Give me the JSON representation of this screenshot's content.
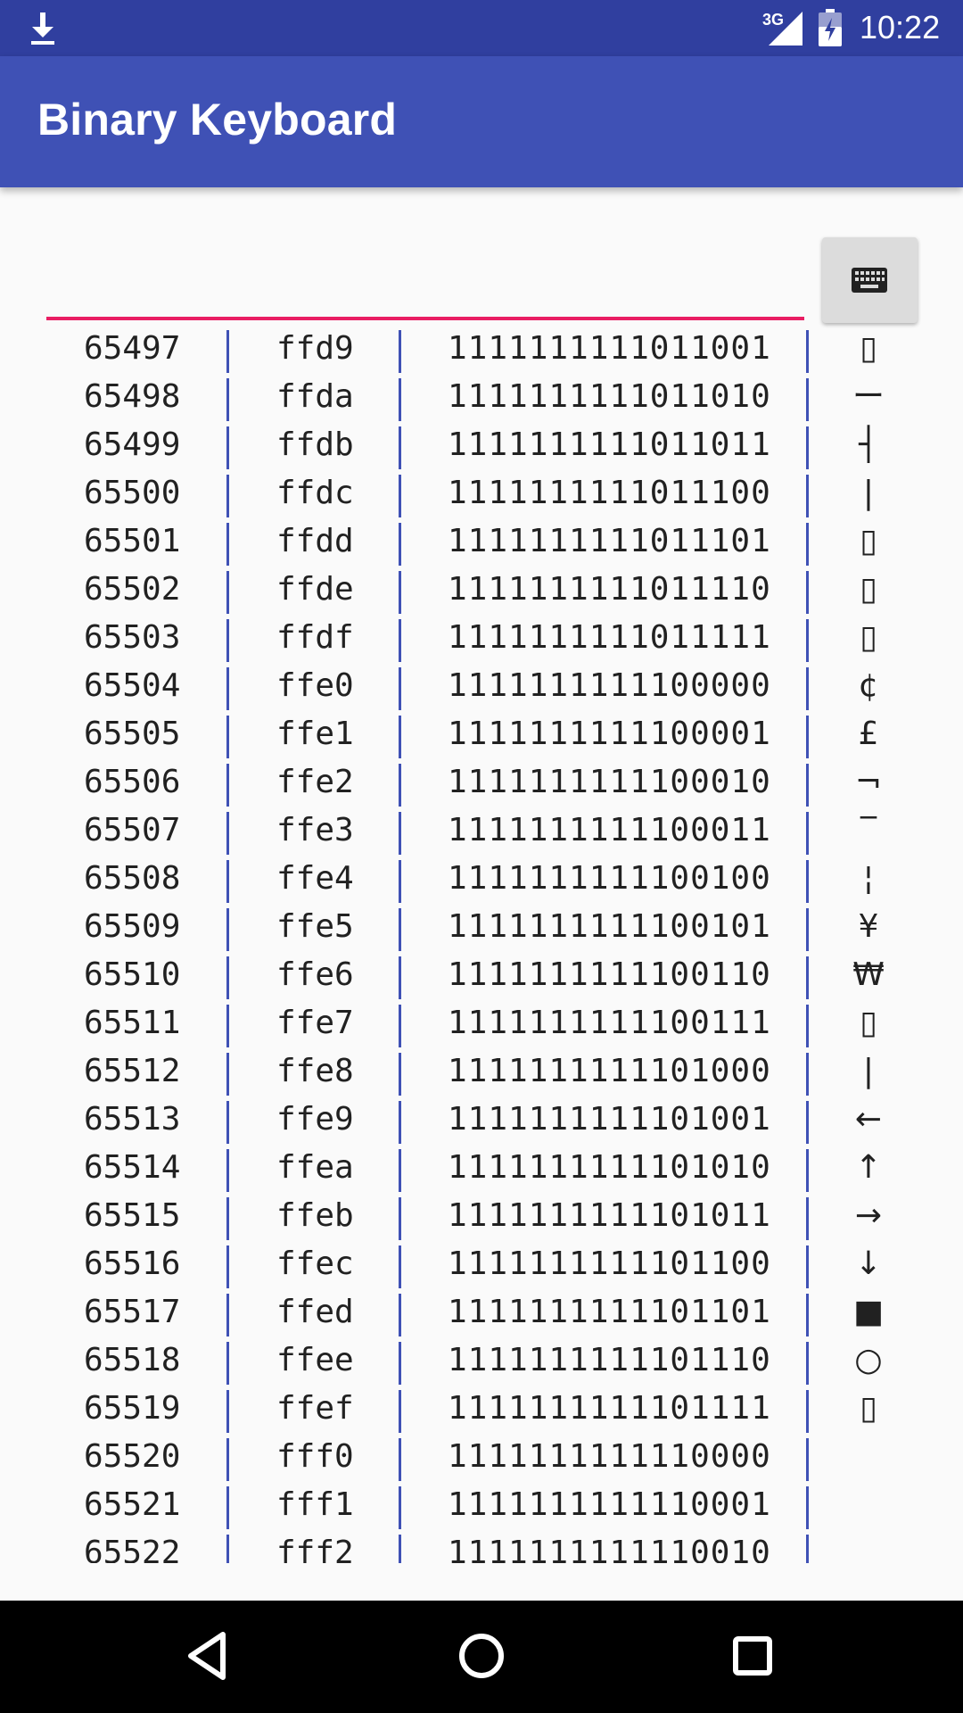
{
  "status_bar": {
    "network_type": "3G",
    "time": "10:22",
    "icons": [
      "download-icon",
      "signal-icon",
      "battery-icon"
    ]
  },
  "app_bar": {
    "title": "Binary Keyboard"
  },
  "input": {
    "value": "",
    "placeholder": ""
  },
  "keyboard_button": {
    "icon": "keyboard-icon"
  },
  "colors": {
    "status_bar": "#303f9f",
    "app_bar": "#3f51b5",
    "accent_underline": "#e91e63",
    "column_divider": "#3f51b5"
  },
  "table": {
    "rows": [
      {
        "dec": "65497",
        "hex": "ffd9",
        "bin": "1111111111011001",
        "chr": "▯"
      },
      {
        "dec": "65498",
        "hex": "ffda",
        "bin": "1111111111011010",
        "chr": "ー"
      },
      {
        "dec": "65499",
        "hex": "ffdb",
        "bin": "1111111111011011",
        "chr": "┤"
      },
      {
        "dec": "65500",
        "hex": "ffdc",
        "bin": "1111111111011100",
        "chr": "|"
      },
      {
        "dec": "65501",
        "hex": "ffdd",
        "bin": "1111111111011101",
        "chr": "▯"
      },
      {
        "dec": "65502",
        "hex": "ffde",
        "bin": "1111111111011110",
        "chr": "▯"
      },
      {
        "dec": "65503",
        "hex": "ffdf",
        "bin": "1111111111011111",
        "chr": "▯"
      },
      {
        "dec": "65504",
        "hex": "ffe0",
        "bin": "1111111111100000",
        "chr": "¢"
      },
      {
        "dec": "65505",
        "hex": "ffe1",
        "bin": "1111111111100001",
        "chr": "£"
      },
      {
        "dec": "65506",
        "hex": "ffe2",
        "bin": "1111111111100010",
        "chr": "¬"
      },
      {
        "dec": "65507",
        "hex": "ffe3",
        "bin": "1111111111100011",
        "chr": "‾"
      },
      {
        "dec": "65508",
        "hex": "ffe4",
        "bin": "1111111111100100",
        "chr": "¦"
      },
      {
        "dec": "65509",
        "hex": "ffe5",
        "bin": "1111111111100101",
        "chr": "¥"
      },
      {
        "dec": "65510",
        "hex": "ffe6",
        "bin": "1111111111100110",
        "chr": "₩"
      },
      {
        "dec": "65511",
        "hex": "ffe7",
        "bin": "1111111111100111",
        "chr": "▯"
      },
      {
        "dec": "65512",
        "hex": "ffe8",
        "bin": "1111111111101000",
        "chr": "|"
      },
      {
        "dec": "65513",
        "hex": "ffe9",
        "bin": "1111111111101001",
        "chr": "←"
      },
      {
        "dec": "65514",
        "hex": "ffea",
        "bin": "1111111111101010",
        "chr": "↑"
      },
      {
        "dec": "65515",
        "hex": "ffeb",
        "bin": "1111111111101011",
        "chr": "→"
      },
      {
        "dec": "65516",
        "hex": "ffec",
        "bin": "1111111111101100",
        "chr": "↓"
      },
      {
        "dec": "65517",
        "hex": "ffed",
        "bin": "1111111111101101",
        "chr": "■"
      },
      {
        "dec": "65518",
        "hex": "ffee",
        "bin": "1111111111101110",
        "chr": "○"
      },
      {
        "dec": "65519",
        "hex": "ffef",
        "bin": "1111111111101111",
        "chr": "▯"
      },
      {
        "dec": "65520",
        "hex": "fff0",
        "bin": "1111111111110000",
        "chr": ""
      },
      {
        "dec": "65521",
        "hex": "fff1",
        "bin": "1111111111110001",
        "chr": ""
      },
      {
        "dec": "65522",
        "hex": "fff2",
        "bin": "1111111111110010",
        "chr": ""
      }
    ]
  },
  "nav_bar": {
    "icons": [
      "back-icon",
      "home-icon",
      "recents-icon"
    ]
  }
}
